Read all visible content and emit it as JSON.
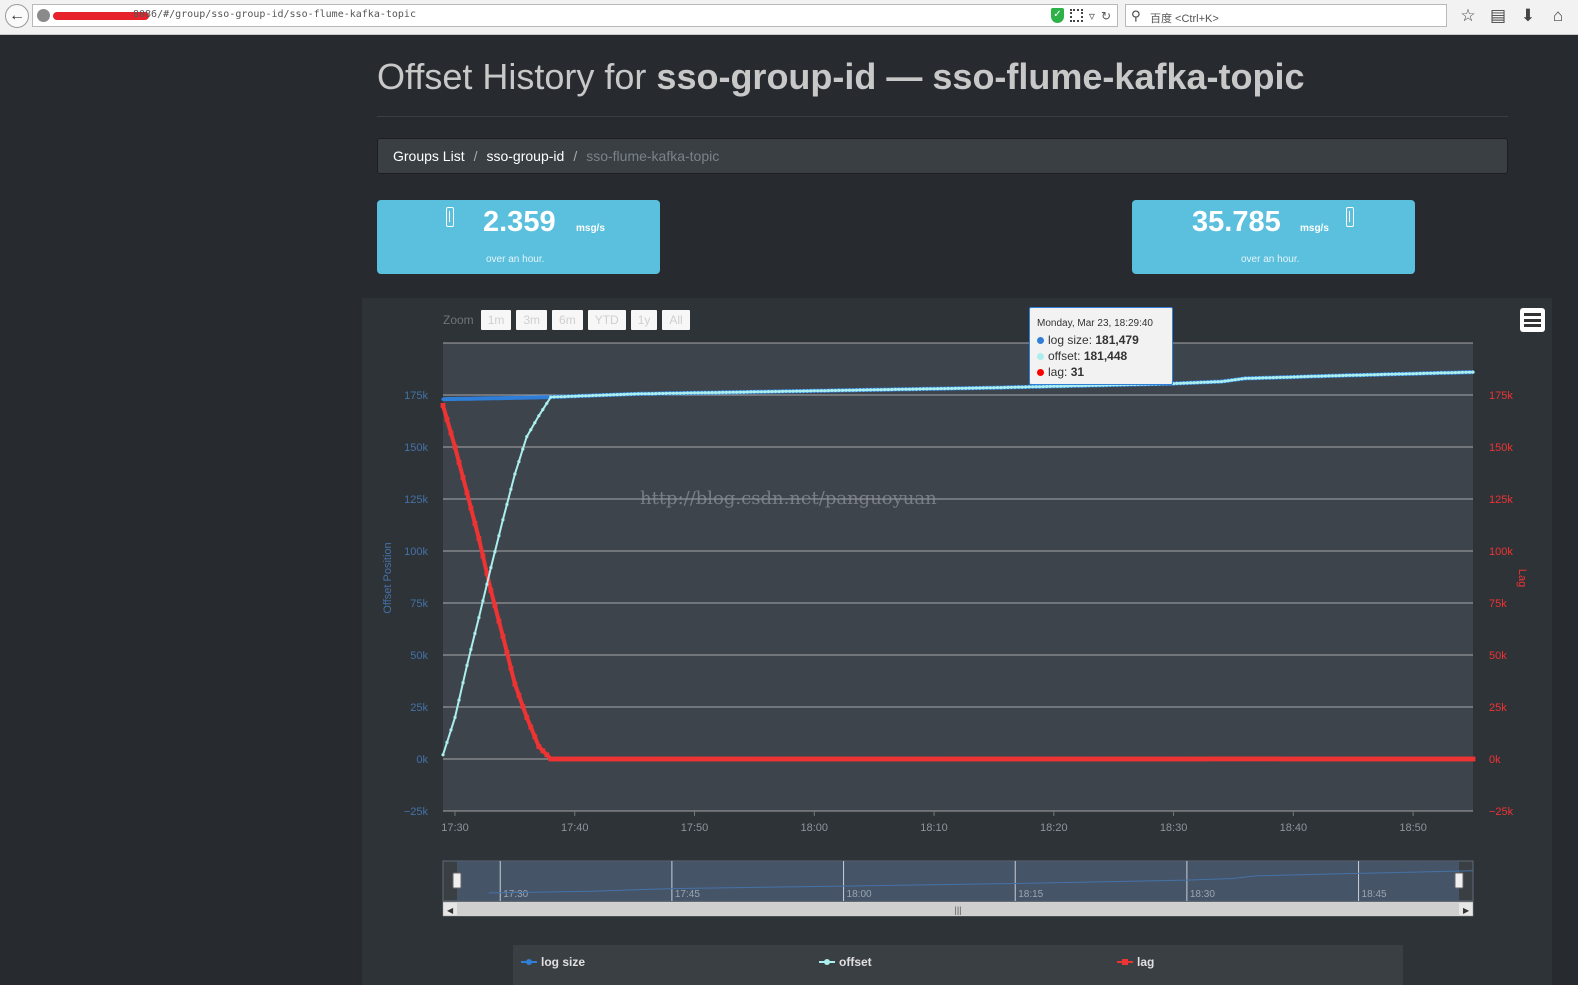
{
  "browser": {
    "url_text": "8086/#/group/sso-group-id/sso-flume-kafka-topic",
    "search_placeholder": "百度 <Ctrl+K>"
  },
  "header": {
    "title_prefix": "Offset History for",
    "title_bold": "sso-group-id — sso-flume-kafka-topic"
  },
  "breadcrumb": {
    "items": [
      "Groups List",
      "sso-group-id"
    ],
    "active": "sso-flume-kafka-topic",
    "separator": "/"
  },
  "stats": [
    {
      "value": "2.359",
      "unit": "msg/s",
      "caption": "over an hour."
    },
    {
      "value": "35.785",
      "unit": "msg/s",
      "caption": "over an hour."
    }
  ],
  "zoom": {
    "label": "Zoom",
    "buttons": [
      "1m",
      "3m",
      "6m",
      "YTD",
      "1y",
      "All"
    ]
  },
  "tooltip": {
    "date": "Monday, Mar 23, 18:29:40",
    "rows": [
      {
        "label": "log size:",
        "value": "181,479",
        "color": "#2f7ed8"
      },
      {
        "label": "offset:",
        "value": "181,448",
        "color": "#aaeeee"
      },
      {
        "label": "lag:",
        "value": "31",
        "color": "#ff0000"
      }
    ]
  },
  "watermark": "http://blog.csdn.net/panguoyuan",
  "colors": {
    "log_size": "#2f7ed8",
    "offset": "#aaeeee",
    "lag": "#ee3333",
    "left_axis_label": "#4572a7",
    "right_axis_label": "#ee3333"
  },
  "chart_data": {
    "type": "line",
    "x_labels": [
      "17:30",
      "17:40",
      "17:50",
      "18:00",
      "18:10",
      "18:20",
      "18:30",
      "18:40",
      "18:50"
    ],
    "y_left": {
      "label": "Offset Position",
      "ticks": [
        "175k",
        "150k",
        "125k",
        "100k",
        "75k",
        "50k",
        "25k",
        "0k",
        "−25k"
      ],
      "ylim": [
        -25000,
        200000
      ]
    },
    "y_right": {
      "label": "Lag",
      "ticks": [
        "175k",
        "150k",
        "125k",
        "100k",
        "75k",
        "50k",
        "25k",
        "0k",
        "−25k"
      ],
      "ylim": [
        -25000,
        200000
      ]
    },
    "grid": true,
    "series": [
      {
        "name": "log size",
        "color": "#2f7ed8",
        "x": [
          "17:29",
          "17:34",
          "17:38",
          "17:45",
          "18:00",
          "18:15",
          "18:30",
          "18:34",
          "18:36",
          "18:45",
          "18:55"
        ],
        "values": [
          173000,
          173500,
          174000,
          175500,
          177000,
          178500,
          180500,
          181479,
          183000,
          184500,
          186000
        ]
      },
      {
        "name": "offset",
        "color": "#aaeeee",
        "x": [
          "17:29",
          "17:30",
          "17:31",
          "17:32",
          "17:33",
          "17:34",
          "17:35",
          "17:36",
          "17:37",
          "17:38",
          "17:45",
          "18:00",
          "18:15",
          "18:30",
          "18:34",
          "18:36",
          "18:45",
          "18:55"
        ],
        "values": [
          2000,
          20000,
          45000,
          68000,
          92000,
          115000,
          137000,
          155000,
          165000,
          174000,
          175500,
          177000,
          178500,
          180500,
          181448,
          183000,
          184500,
          186000
        ]
      },
      {
        "name": "lag",
        "color": "#ee3333",
        "x": [
          "17:29",
          "17:30",
          "17:31",
          "17:32",
          "17:33",
          "17:34",
          "17:35",
          "17:36",
          "17:37",
          "17:38",
          "18:00",
          "18:30",
          "18:34",
          "18:55"
        ],
        "values": [
          170000,
          150000,
          128000,
          106000,
          81000,
          59000,
          36000,
          20000,
          6000,
          0,
          0,
          0,
          31,
          0
        ]
      }
    ],
    "navigator": {
      "x_labels": [
        "17:30",
        "17:45",
        "18:00",
        "18:15",
        "18:30",
        "18:45"
      ]
    },
    "legend": {
      "placement": "bottom",
      "items": [
        "log size",
        "offset",
        "lag"
      ]
    }
  }
}
